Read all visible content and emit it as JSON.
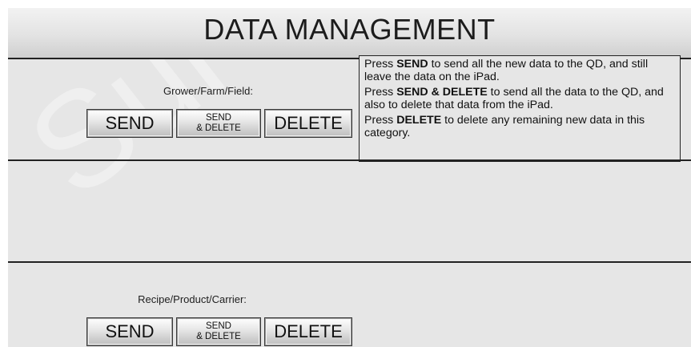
{
  "header": {
    "title": "DATA MANAGEMENT"
  },
  "sections": [
    {
      "label": "Grower/Farm/Field:",
      "send_label": "SEND",
      "send_delete_line1": "SEND",
      "send_delete_line2": "& DELETE",
      "delete_label": "DELETE"
    },
    {
      "label": "Recipe/Product/Carrier:",
      "send_label": "SEND",
      "send_delete_line1": "SEND",
      "send_delete_line2": "& DELETE",
      "delete_label": "DELETE"
    }
  ],
  "help": {
    "p1_pre": "Press ",
    "p1_bold": "SEND",
    "p1_post": " to send all the new data to the QD, and still leave the data on the iPad.",
    "p2_pre": "Press ",
    "p2_bold": "SEND & DELETE",
    "p2_post": " to send all the data to the QD, and also to delete that data from the iPad.",
    "p3_pre": "Press ",
    "p3_bold": "DELETE",
    "p3_post": " to delete any remaining new data in this category."
  },
  "colors": {
    "panel_background": "#e6e6e6",
    "divider": "#222222",
    "text": "#1c1c1c"
  }
}
